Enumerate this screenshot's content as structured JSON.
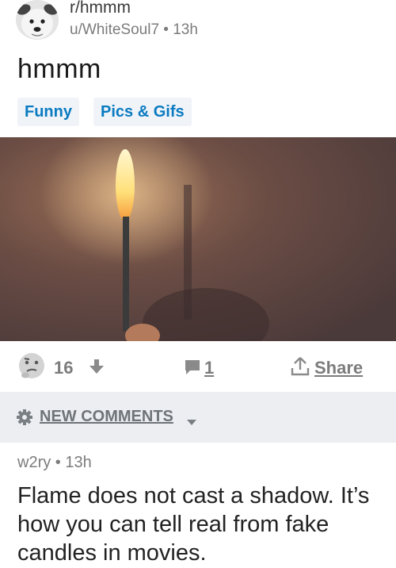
{
  "post": {
    "subreddit": "r/hmmm",
    "author": "u/WhiteSoul7",
    "separator": "•",
    "age": "13h",
    "title": "hmmm",
    "flairs": [
      "Funny",
      "Pics & Gifs"
    ]
  },
  "actions": {
    "vote_count": "16",
    "comment_count": "1",
    "share_label": "Share"
  },
  "comments_bar": {
    "sort_label": "NEW COMMENTS"
  },
  "comment": {
    "author": "w2ry",
    "separator": "•",
    "age": "13h",
    "body": "Flame does not cast a shadow. It’s how you can tell real from fake candles in movies."
  },
  "icons": {
    "subreddit_avatar": "dog-avatar-icon",
    "vote_face": "thinking-face-icon",
    "downvote": "downvote-arrow-icon",
    "comment": "comment-bubble-icon",
    "share": "share-upload-icon",
    "sort": "gear-icon",
    "sort_caret": "caret-down-icon"
  },
  "colors": {
    "flair_text": "#0a7bc1",
    "flair_background": "#f0f3f8",
    "muted_text": "#7c7c7c",
    "comments_bar_background": "#eceef1"
  }
}
